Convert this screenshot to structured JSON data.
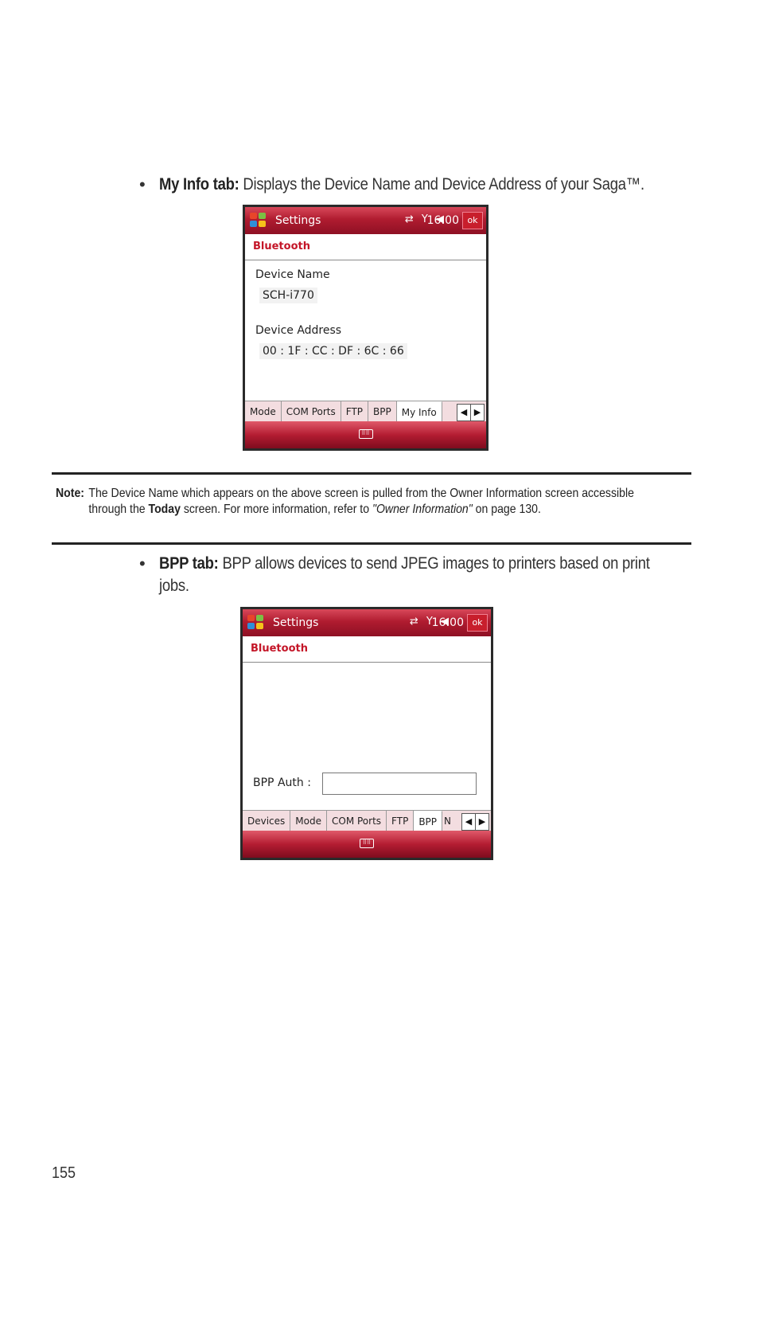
{
  "bullet1": {
    "label": "My Info tab:",
    "text": "Displays the Device Name and Device Address of your Saga™."
  },
  "screen1": {
    "title": "Settings",
    "time": "16:00",
    "ok": "ok",
    "section": "Bluetooth",
    "device_name_label": "Device Name",
    "device_name": "SCH-i770",
    "device_address_label": "Device Address",
    "device_address": "00 : 1F : CC : DF : 6C : 66",
    "tabs": [
      "Mode",
      "COM Ports",
      "FTP",
      "BPP",
      "My Info"
    ],
    "active_tab": "My Info"
  },
  "note": {
    "label": "Note:",
    "text_1": "The Device Name which appears on the above screen is pulled from the Owner Information screen accessible through the ",
    "bold": "Today",
    "text_2": " screen. For more information, refer to ",
    "ref": "\"Owner Information\"",
    "text_3": "  on page 130."
  },
  "bullet2": {
    "label": "BPP tab:",
    "text": "BPP allows devices to send JPEG images to printers based on print jobs."
  },
  "screen2": {
    "title": "Settings",
    "time": "16:00",
    "ok": "ok",
    "section": "Bluetooth",
    "bpp_auth_label": "BPP Auth :",
    "bpp_auth_value": "",
    "tabs": [
      "Devices",
      "Mode",
      "COM Ports",
      "FTP",
      "BPP",
      "N"
    ],
    "active_tab": "BPP"
  },
  "page_number": "155",
  "colors": {
    "title_bar": "#b01c30",
    "section_text": "#c41628"
  }
}
